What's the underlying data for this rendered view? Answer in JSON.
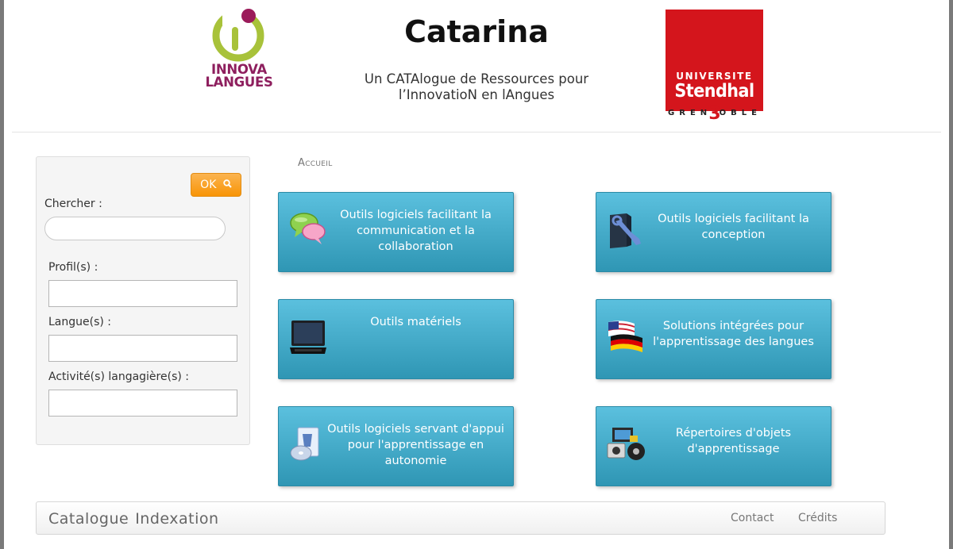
{
  "header": {
    "title": "Catarina",
    "subtitle_line1": "Un CATAlogue de Ressources pour",
    "subtitle_line2": "l’InnovatioN en lAngues",
    "logo_left": {
      "line1": "INNOVA",
      "line2": "LANGUES",
      "colors": {
        "ring": "#a8c23a",
        "dot": "#9b1b5a"
      }
    },
    "logo_right": {
      "line1": "UNIVERSITE",
      "line2": "Stendhal",
      "line3": "GREN  OBLE",
      "digit": "3",
      "color": "#d4151c"
    }
  },
  "sidebar": {
    "ok_label": "OK",
    "search_label": "Chercher :",
    "search_value": "",
    "profils_label": "Profil(s) :",
    "langues_label": "Langue(s) :",
    "activites_label": "Activité(s) langagière(s) :"
  },
  "breadcrumb": {
    "home": "Accueil"
  },
  "tiles": [
    {
      "label": "Outils logiciels facilitant la communication et la collaboration",
      "icon": "chat-bubbles-icon"
    },
    {
      "label": "Outils logiciels facilitant la conception",
      "icon": "wrench-tool-icon"
    },
    {
      "label": "Outils matériels",
      "icon": "laptop-icon"
    },
    {
      "label": "Solutions intégrées pour l'apprentissage des langues",
      "icon": "flags-icon"
    },
    {
      "label": "Outils logiciels servant d'appui pour l'apprentissage en autonomie",
      "icon": "software-cd-icon"
    },
    {
      "label": "Répertoires d'objets d'apprentissage",
      "icon": "media-objects-icon"
    }
  ],
  "footer": {
    "brand_catalogue": "Catalogue",
    "brand_indexation": "Indexation",
    "contact": "Contact",
    "credits": "Crédits"
  },
  "colors": {
    "tile_top": "#5bc0de",
    "tile_bottom": "#2f96b4",
    "ok_button": "#f89406"
  }
}
